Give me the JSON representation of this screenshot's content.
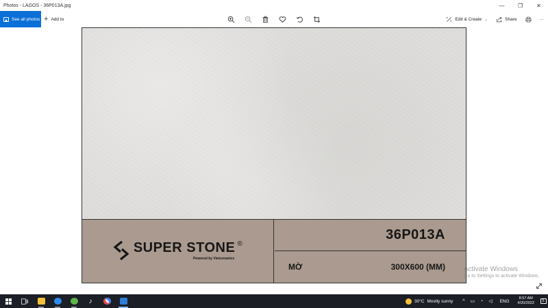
{
  "window": {
    "title": "Photos - LAGOS - 36P013A.jpg",
    "minimize_glyph": "—",
    "maximize_glyph": "❐",
    "close_glyph": "✕"
  },
  "toolbar": {
    "see_all_label": "See all photos",
    "add_to_label": "Add to",
    "edit_create_label": "Edit & Create",
    "share_label": "Share",
    "more_glyph": "···"
  },
  "image": {
    "brand": "SUPER STONE",
    "registered": "®",
    "powered_by": "Powered by Vietceramics",
    "code": "36P013A",
    "finish": "MỜ",
    "size": "300X600 (MM)"
  },
  "watermark": {
    "line1": "Activate Windows",
    "line2": "Go to Settings to activate Windows."
  },
  "taskbar": {
    "weather_temp": "30°C",
    "weather_text": "Mostly sunny",
    "language": "ENG",
    "time": "8:57 AM",
    "date": "4/20/2022",
    "notifications": "5"
  }
}
